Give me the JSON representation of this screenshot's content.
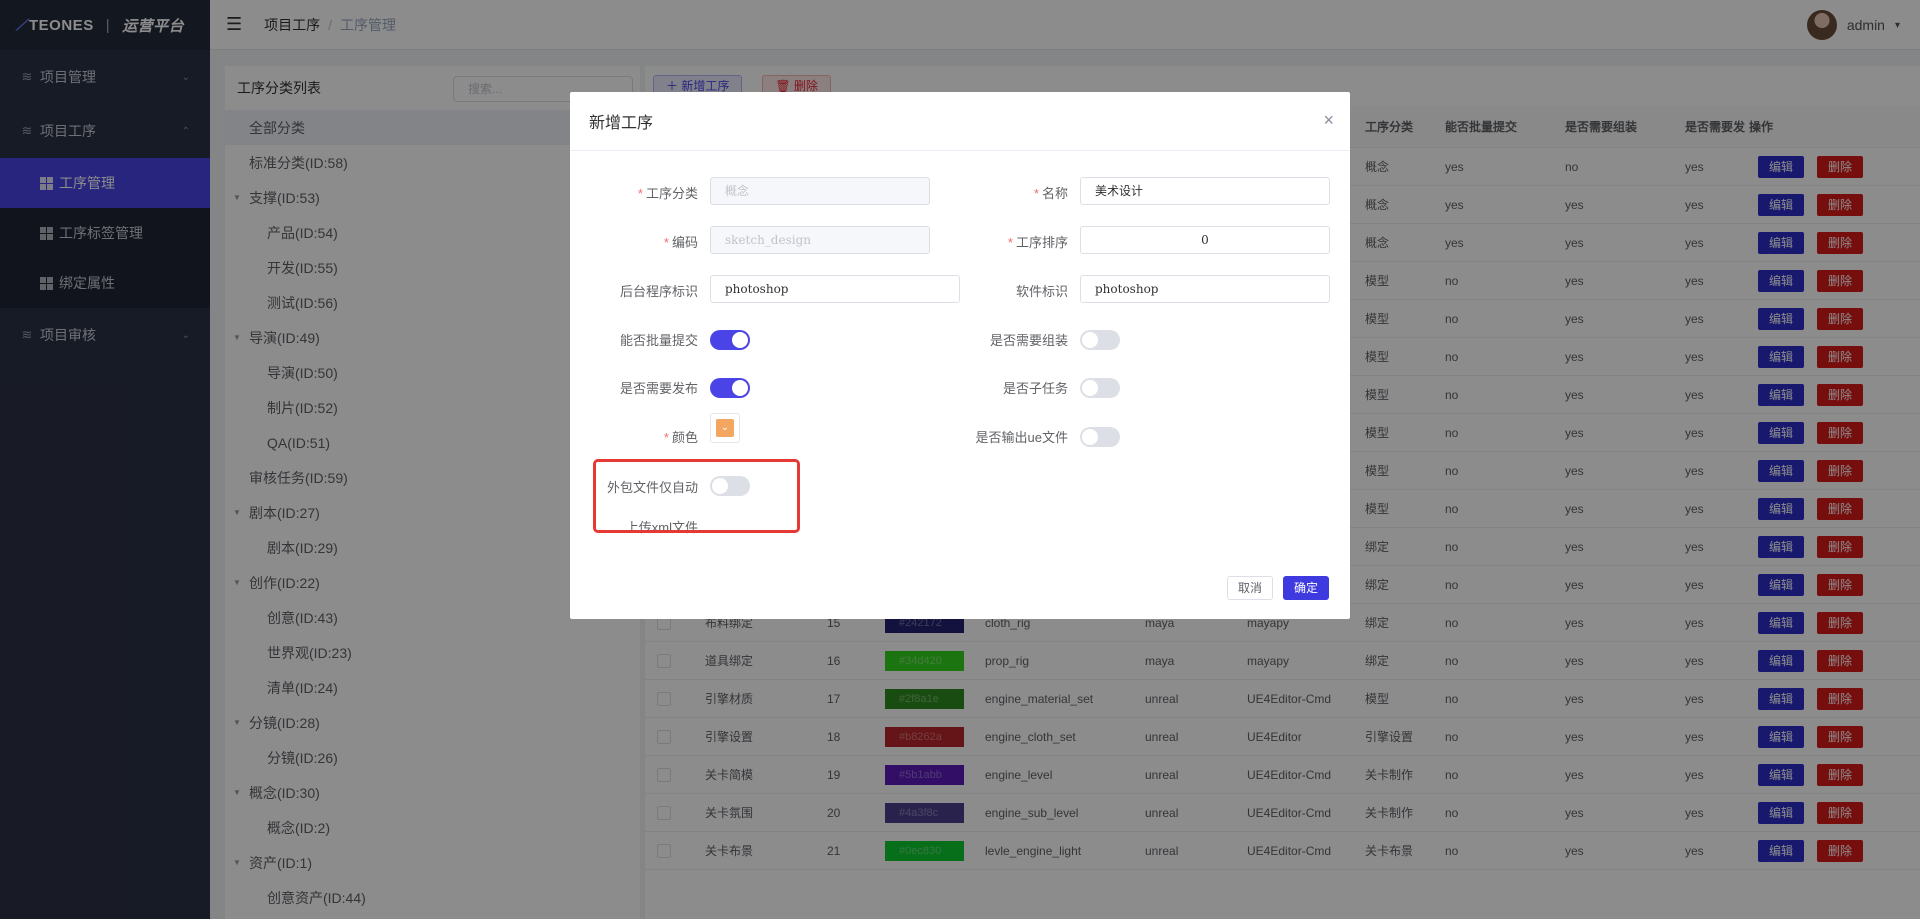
{
  "app": {
    "logo_main": "TEONES",
    "logo_sep": "|",
    "logo_sub": "运营平台"
  },
  "sidebar": {
    "items": [
      {
        "label": "项目管理",
        "icon": "layers-icon",
        "arrow": "⌄"
      },
      {
        "label": "项目工序",
        "icon": "layers-icon",
        "arrow": "⌃"
      },
      {
        "label": "项目审核",
        "icon": "layers-icon",
        "arrow": "⌄"
      }
    ],
    "sub_items": [
      {
        "label": "工序管理",
        "active": true
      },
      {
        "label": "工序标签管理"
      },
      {
        "label": "绑定属性"
      }
    ]
  },
  "header": {
    "breadcrumb": [
      "项目工序",
      "工序管理"
    ],
    "separator": "/",
    "user": "admin",
    "user_caret": "▾"
  },
  "tree": {
    "title": "工序分类列表",
    "search_placeholder": "搜索...",
    "nodes": [
      {
        "label": "全部分类"
      },
      {
        "label": "标准分类(ID:58)"
      },
      {
        "label": "支撑(ID:53)"
      },
      {
        "label": "产品(ID:54)"
      },
      {
        "label": "开发(ID:55)"
      },
      {
        "label": "测试(ID:56)"
      },
      {
        "label": "导演(ID:49)"
      },
      {
        "label": "导演(ID:50)"
      },
      {
        "label": "制片(ID:52)"
      },
      {
        "label": "QA(ID:51)"
      },
      {
        "label": "审核任务(ID:59)"
      },
      {
        "label": "剧本(ID:27)"
      },
      {
        "label": "剧本(ID:29)"
      },
      {
        "label": "创作(ID:22)"
      },
      {
        "label": "创意(ID:43)"
      },
      {
        "label": "世界观(ID:23)"
      },
      {
        "label": "清单(ID:24)"
      },
      {
        "label": "分镜(ID:28)"
      },
      {
        "label": "分镜(ID:26)"
      },
      {
        "label": "概念(ID:30)"
      },
      {
        "label": "概念(ID:2)"
      },
      {
        "label": "资产(ID:1)"
      },
      {
        "label": "创意资产(ID:44)"
      }
    ]
  },
  "toolbar": {
    "add_label": "＋ 新增工序",
    "delete_label": "🗑 删除"
  },
  "table": {
    "headers": [
      "工序分类",
      "能否批量提交",
      "是否需要组装",
      "是否需要发",
      "操作"
    ],
    "edit_label": "编辑",
    "delete_label": "删除",
    "top_rows": [
      [
        "概念",
        "yes",
        "no",
        "yes"
      ],
      [
        "概念",
        "yes",
        "yes",
        "yes"
      ],
      [
        "概念",
        "yes",
        "yes",
        "yes"
      ],
      [
        "模型",
        "no",
        "yes",
        "yes"
      ],
      [
        "模型",
        "no",
        "yes",
        "yes"
      ],
      [
        "模型",
        "no",
        "yes",
        "yes"
      ],
      [
        "模型",
        "no",
        "yes",
        "yes"
      ],
      [
        "模型",
        "no",
        "yes",
        "yes"
      ],
      [
        "模型",
        "no",
        "yes",
        "yes"
      ],
      [
        "模型",
        "no",
        "yes",
        "yes"
      ],
      [
        "绑定",
        "no",
        "yes",
        "yes"
      ],
      [
        "绑定",
        "no",
        "yes",
        "yes"
      ]
    ],
    "rows": [
      {
        "name": "布料绑定",
        "id": "15",
        "color": "#242172",
        "code": "cloth_rig",
        "app": "maya",
        "exe": "mayapy",
        "cat": "绑定",
        "batch": "no",
        "assemble": "yes",
        "publish": "yes"
      },
      {
        "name": "道具绑定",
        "id": "16",
        "color": "#34d420",
        "code": "prop_rig",
        "app": "maya",
        "exe": "mayapy",
        "cat": "绑定",
        "batch": "no",
        "assemble": "yes",
        "publish": "yes"
      },
      {
        "name": "引擎材质",
        "id": "17",
        "color": "#2f8a1e",
        "code": "engine_material_set",
        "app": "unreal",
        "exe": "UE4Editor-Cmd",
        "cat": "模型",
        "batch": "no",
        "assemble": "yes",
        "publish": "yes"
      },
      {
        "name": "引擎设置",
        "id": "18",
        "color": "#b8262a",
        "code": "engine_cloth_set",
        "app": "unreal",
        "exe": "UE4Editor",
        "cat": "引擎设置",
        "batch": "no",
        "assemble": "yes",
        "publish": "yes"
      },
      {
        "name": "关卡简模",
        "id": "19",
        "color": "#5b1abb",
        "code": "engine_level",
        "app": "unreal",
        "exe": "UE4Editor-Cmd",
        "cat": "关卡制作",
        "batch": "no",
        "assemble": "yes",
        "publish": "yes"
      },
      {
        "name": "关卡氛围",
        "id": "20",
        "color": "#4a3f8c",
        "code": "engine_sub_level",
        "app": "unreal",
        "exe": "UE4Editor-Cmd",
        "cat": "关卡制作",
        "batch": "no",
        "assemble": "yes",
        "publish": "yes"
      },
      {
        "name": "关卡布景",
        "id": "21",
        "color": "#0ec830",
        "code": "levle_engine_light",
        "app": "unreal",
        "exe": "UE4Editor-Cmd",
        "cat": "关卡布景",
        "batch": "no",
        "assemble": "yes",
        "publish": "yes"
      }
    ]
  },
  "dialog": {
    "title": "新增工序",
    "close_icon": "×",
    "fields": {
      "category": {
        "label": "工序分类",
        "value": "概念"
      },
      "name": {
        "label": "名称",
        "value": "美术设计"
      },
      "code": {
        "label": "编码",
        "value": "sketch_design"
      },
      "order": {
        "label": "工序排序",
        "value": "0"
      },
      "backend": {
        "label": "后台程序标识",
        "value": "photoshop"
      },
      "software": {
        "label": "软件标识",
        "value": "photoshop"
      },
      "batch": {
        "label": "能否批量提交",
        "on": true
      },
      "assemble": {
        "label": "是否需要组装",
        "on": false
      },
      "publish": {
        "label": "是否需要发布",
        "on": true
      },
      "subtask": {
        "label": "是否子任务",
        "on": false
      },
      "color": {
        "label": "颜色",
        "value": "#f3a65f"
      },
      "ue_output": {
        "label": "是否输出ue文件",
        "on": false
      },
      "outsource": {
        "label_line1": "外包文件仅自动",
        "label_line2": "上传xml文件",
        "on": false
      }
    },
    "cancel": "取消",
    "ok": "确定",
    "highlight_color": "#e53935"
  }
}
